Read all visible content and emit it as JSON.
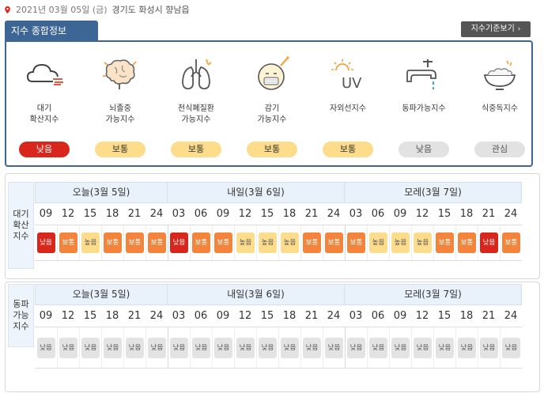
{
  "header": {
    "date_text": "2021년 03월 05일 (금)",
    "location": "경기도 화성시 향남읍"
  },
  "summary": {
    "title": "지수 종합정보",
    "standard_button": "지수기준보기",
    "items": [
      {
        "name_line1": "대기",
        "name_line2": "확산지수",
        "level": "낮음",
        "icon": "cloud-wind-icon"
      },
      {
        "name_line1": "뇌졸중",
        "name_line2": "가능지수",
        "level": "보통",
        "icon": "brain-icon"
      },
      {
        "name_line1": "천식폐질환",
        "name_line2": "가능지수",
        "level": "보통",
        "icon": "lungs-icon"
      },
      {
        "name_line1": "감기",
        "name_line2": "가능지수",
        "level": "보통",
        "icon": "sick-face-icon"
      },
      {
        "name_line1": "자외선지수",
        "name_line2": "",
        "level": "보통",
        "icon": "uv-icon"
      },
      {
        "name_line1": "동파가능지수",
        "name_line2": "",
        "level": "낮음",
        "icon": "faucet-icon"
      },
      {
        "name_line1": "식중독지수",
        "name_line2": "",
        "level": "관심",
        "icon": "food-bowl-icon"
      }
    ],
    "colors": {
      "primary": "#3d6694",
      "low_red": "#d9261c",
      "normal": "#fddc8c",
      "gray": "#e2e2e2"
    }
  },
  "forecast_air": {
    "label_lines": [
      "대기",
      "확산",
      "지수"
    ],
    "days": [
      "오늘(3월 5일)",
      "내일(3월 6일)",
      "모레(3월 7일)"
    ],
    "hours": [
      "09",
      "12",
      "15",
      "18",
      "21",
      "24",
      "03",
      "06",
      "09",
      "12",
      "15",
      "18",
      "21",
      "24",
      "03",
      "06",
      "09",
      "12",
      "15",
      "18",
      "21",
      "24"
    ],
    "values": [
      "낮음",
      "보통",
      "높음",
      "보통",
      "보통",
      "보통",
      "낮음",
      "보통",
      "보통",
      "높음",
      "높음",
      "높음",
      "보통",
      "보통",
      "보통",
      "높음",
      "높음",
      "높음",
      "보통",
      "보통",
      "낮음",
      "보통"
    ]
  },
  "forecast_freeze": {
    "label_lines": [
      "동파",
      "가능",
      "지수"
    ],
    "days": [
      "오늘(3월 5일)",
      "내일(3월 6일)",
      "모레(3월 7일)"
    ],
    "hours": [
      "09",
      "12",
      "15",
      "18",
      "21",
      "24",
      "03",
      "06",
      "09",
      "12",
      "15",
      "18",
      "21",
      "24",
      "03",
      "06",
      "09",
      "12",
      "15",
      "18",
      "21",
      "24"
    ],
    "values": [
      "낮음",
      "낮음",
      "낮음",
      "낮음",
      "낮음",
      "낮음",
      "낮음",
      "낮음",
      "낮음",
      "낮음",
      "낮음",
      "낮음",
      "낮음",
      "낮음",
      "낮음",
      "낮음",
      "낮음",
      "낮음",
      "낮음",
      "낮음",
      "낮음",
      "낮음"
    ]
  }
}
